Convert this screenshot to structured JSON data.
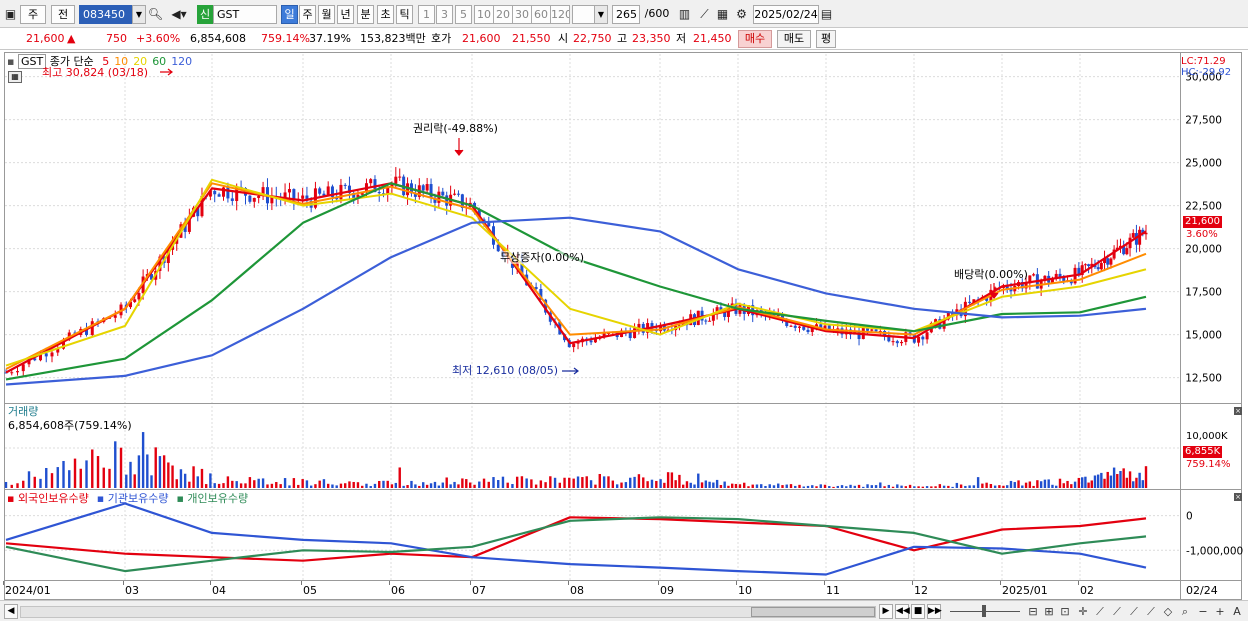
{
  "toolbar": {
    "market": "주",
    "prefix": "전",
    "code": "083450",
    "name_tag": "신",
    "name": "GST",
    "periods": [
      "일",
      "주",
      "월",
      "년",
      "분",
      "초",
      "틱"
    ],
    "active_period": "일",
    "intervals": [
      "1",
      "3",
      "5",
      "10",
      "20",
      "30",
      "60",
      "120"
    ],
    "count": "265",
    "count_total": "/600",
    "date": "2025/02/24"
  },
  "quote": {
    "price": "21,600",
    "direction": "▲",
    "change": "750",
    "change_pct": "+3.60%",
    "volume": "6,854,608",
    "volume_pct": "759.14%",
    "turnover_pct": "37.19%",
    "amount": "153,823백만",
    "hoga_label": "호가",
    "ask": "21,600",
    "bid": "21,550",
    "open_label": "시",
    "open": "22,750",
    "high_label": "고",
    "high": "23,350",
    "low_label": "저",
    "low": "21,450",
    "buy_label": "매수",
    "sell_label": "매도",
    "eval_label": "평"
  },
  "price_panel": {
    "ticker": "GST",
    "legend_title": "종가 단순",
    "ma": [
      {
        "period": "5",
        "color": "#e3000f"
      },
      {
        "period": "10",
        "color": "#ff8c00"
      },
      {
        "period": "20",
        "color": "#e6d400"
      },
      {
        "period": "60",
        "color": "#1e9638"
      },
      {
        "period": "120",
        "color": "#3c5fd8"
      }
    ],
    "high_note": "최고 30,824 (03/18)",
    "low_note": "최저 12,610 (08/05)",
    "event_rights": "권리락(-49.88%)",
    "event_bonus": "무상증자(0.00%)",
    "event_dividend": "배당락(0.00%)",
    "lc": "LC:71.29",
    "hc": "HC:-29.92",
    "price_tag": "21,600",
    "pct_tag": "3.60%"
  },
  "volume_panel": {
    "title": "거래량",
    "value": "6,854,608주(759.14%)",
    "axis_label": "10,000K",
    "tag_value": "6,855K",
    "tag_pct": "759.14%"
  },
  "holdings_panel": {
    "series": [
      {
        "name": "외국인보유수량",
        "color": "#e3000f"
      },
      {
        "name": "기관보유수량",
        "color": "#2f55d4"
      },
      {
        "name": "개인보유수량",
        "color": "#2e8b57"
      }
    ]
  },
  "x_axis": {
    "labels": [
      "2024/01",
      "03",
      "04",
      "05",
      "06",
      "07",
      "08",
      "09",
      "10",
      "11",
      "12",
      "2025/01",
      "02"
    ],
    "last": "02/24"
  },
  "chart_data": [
    {
      "type": "line",
      "title": "GST",
      "x": [
        "2024/01",
        "03",
        "04",
        "05",
        "06",
        "07",
        "08",
        "09",
        "10",
        "11",
        "12",
        "2025/01",
        "02",
        "02/24"
      ],
      "y_ticks": [
        30000,
        27500,
        25000,
        22500,
        20000,
        17500,
        15000,
        12500
      ],
      "ylim": [
        11200,
        31200
      ],
      "series": [
        {
          "name": "5",
          "values": [
            12800,
            16500,
            23500,
            22800,
            23800,
            22500,
            14500,
            15500,
            16500,
            15200,
            14800,
            17800,
            18500,
            21000
          ]
        },
        {
          "name": "10",
          "values": [
            13000,
            16500,
            23800,
            22600,
            23600,
            22300,
            15000,
            15300,
            16600,
            15300,
            15000,
            17600,
            18200,
            19700
          ]
        },
        {
          "name": "20",
          "values": [
            13200,
            15500,
            24000,
            22500,
            23200,
            21800,
            16500,
            15000,
            16800,
            15600,
            15200,
            17200,
            17800,
            18800
          ]
        },
        {
          "name": "60",
          "values": [
            12400,
            13600,
            17000,
            21500,
            23800,
            22500,
            19500,
            17800,
            16500,
            15800,
            15200,
            16200,
            16300,
            17200
          ]
        },
        {
          "name": "120",
          "values": [
            12100,
            12600,
            13800,
            16500,
            19500,
            21500,
            21800,
            21000,
            18800,
            17400,
            16500,
            16000,
            16100,
            16500
          ]
        }
      ]
    },
    {
      "type": "bar",
      "title": "거래량",
      "x": [
        "2024/01",
        "03",
        "04",
        "05",
        "06",
        "07",
        "08",
        "09",
        "10",
        "11",
        "12",
        "2025/01",
        "02",
        "02/24"
      ],
      "values": [
        1800,
        12000,
        3200,
        2100,
        1600,
        2800,
        2600,
        4000,
        1200,
        900,
        800,
        1500,
        2300,
        6855
      ],
      "ylim": [
        0,
        14000
      ]
    },
    {
      "type": "line",
      "title": "보유수량",
      "x": [
        "2024/01",
        "03",
        "04",
        "05",
        "06",
        "07",
        "08",
        "09",
        "10",
        "11",
        "12",
        "2025/01",
        "02",
        "02/24"
      ],
      "y_ticks": [
        0,
        -1000000
      ],
      "ylim": [
        -1800000,
        450000
      ],
      "series": [
        {
          "name": "외국인보유수량",
          "values": [
            -800000,
            -1100000,
            -1200000,
            -1300000,
            -1100000,
            -1200000,
            -50000,
            -100000,
            -200000,
            -300000,
            -1000000,
            -400000,
            -300000,
            -80000
          ]
        },
        {
          "name": "기관보유수량",
          "values": [
            -700000,
            350000,
            -500000,
            -700000,
            -800000,
            -1200000,
            -1400000,
            -1500000,
            -1600000,
            -1700000,
            -900000,
            -950000,
            -1100000,
            -1500000
          ]
        },
        {
          "name": "개인보유수량",
          "values": [
            -900000,
            -1600000,
            -1300000,
            -1000000,
            -1050000,
            -900000,
            -150000,
            -50000,
            -100000,
            -300000,
            -500000,
            -1100000,
            -800000,
            -600000
          ]
        }
      ]
    }
  ]
}
